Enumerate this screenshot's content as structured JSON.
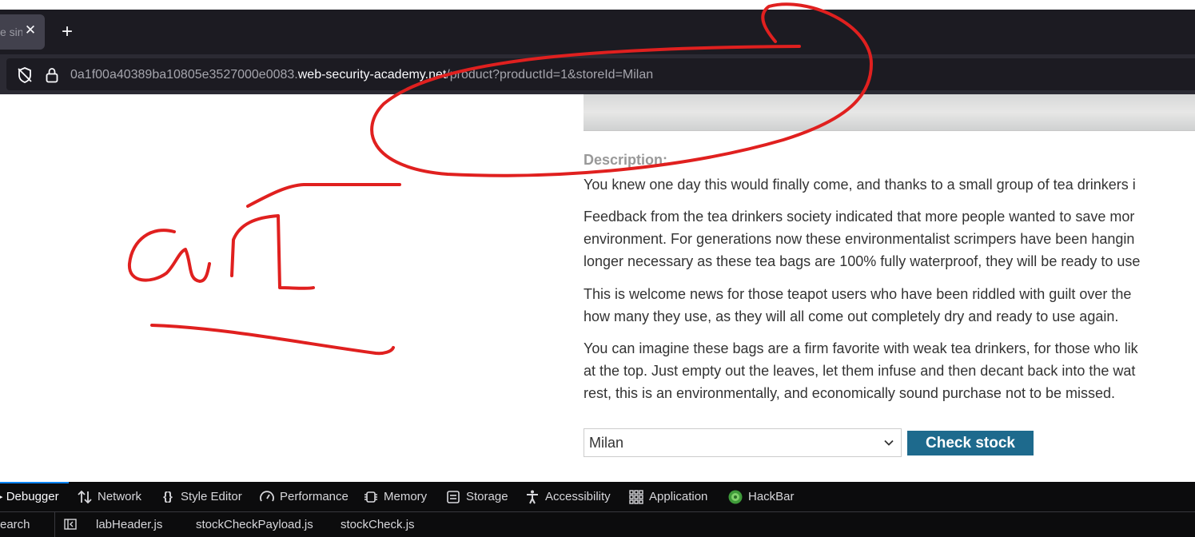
{
  "browser": {
    "tab": {
      "title": "e sin",
      "close_glyph": "✕"
    },
    "new_tab_glyph": "+",
    "url": {
      "prefix": "0a1f00a40389ba10805e3527000e0083.",
      "host": "web-security-academy.net",
      "path": "/product?productId=1&storeId=Milan"
    },
    "icons": [
      "tracking-protection-shield-icon",
      "lock-icon"
    ]
  },
  "product": {
    "description_heading": "Description:",
    "paragraphs": [
      "You knew one day this would finally come, and thanks to a small group of tea drinkers i",
      "Feedback from the tea drinkers society indicated that more people wanted to save mor\nenvironment. For generations now these environmentalist scrimpers have been hangin\nlonger necessary as these tea bags are 100% fully waterproof, they will be ready to use",
      "This is welcome news for those teapot users who have been riddled with guilt over the\nhow many they use, as they will all come out completely dry and ready to use again.",
      "You can imagine these bags are a firm favorite with weak tea drinkers, for those who lik\nat the top. Just empty out the leaves, let them infuse and then decant back into the wat\nrest, this is an environmentally, and economically sound purchase not to be missed."
    ],
    "store_select": {
      "value": "Milan"
    },
    "check_stock_label": "Check stock",
    "button_color": "#1e6a8d"
  },
  "devtools": {
    "tabs": [
      {
        "label": "Debugger",
        "icon": "debugger-icon",
        "active": true
      },
      {
        "label": "Network",
        "icon": "network-arrows-icon"
      },
      {
        "label": "Style Editor",
        "icon": "braces-icon"
      },
      {
        "label": "Performance",
        "icon": "gauge-icon"
      },
      {
        "label": "Memory",
        "icon": "chip-icon"
      },
      {
        "label": "Storage",
        "icon": "storage-icon"
      },
      {
        "label": "Accessibility",
        "icon": "accessibility-icon"
      },
      {
        "label": "Application",
        "icon": "grid-icon"
      },
      {
        "label": "HackBar",
        "icon": "hackbar-icon"
      }
    ],
    "search_label": "earch",
    "files": [
      "labHeader.js",
      "stockCheckPayload.js",
      "stockCheck.js"
    ]
  },
  "annotation": {
    "color": "#e0201f",
    "text": "URL"
  }
}
